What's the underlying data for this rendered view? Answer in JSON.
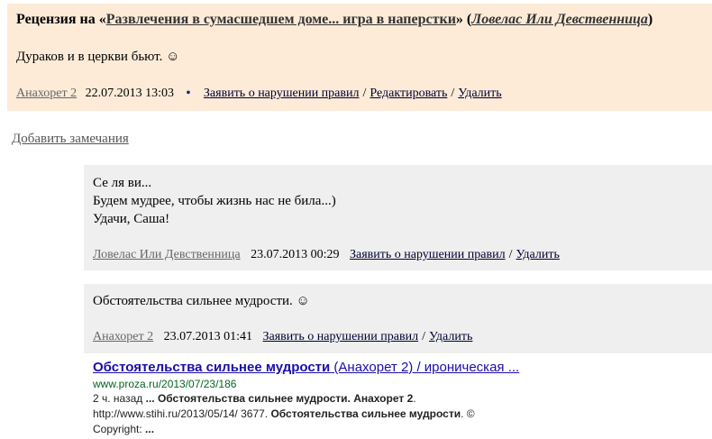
{
  "review": {
    "prefix": "Рецензия на «",
    "work_title": "Развлечения в сумасшедшем доме... игра в наперстки",
    "middle": "» (",
    "author": "Ловелас Или Девственница",
    "suffix": ")",
    "body": "Дураков и в церкви бьют. ☺",
    "user": "Анахорет 2",
    "timestamp": "22.07.2013 13:03",
    "bullet": "•",
    "report_label": "Заявить о нарушении правил",
    "edit_label": "Редактировать",
    "delete_label": "Удалить",
    "separator": "/"
  },
  "add_remarks_label": "Добавить замечания",
  "comments": [
    {
      "lines": [
        "Се ля ви...",
        "Будем мудрее, чтобы жизнь нас не била...)",
        "Удачи, Саша!"
      ],
      "user": "Ловелас Или Девственница",
      "timestamp": "23.07.2013 00:29",
      "report_label": "Заявить о нарушении правил",
      "delete_label": "Удалить"
    },
    {
      "lines": [
        "Обстоятельства сильнее мудрости. ☺"
      ],
      "user": "Анахорет 2",
      "timestamp": "23.07.2013 01:41",
      "report_label": "Заявить о нарушении правил",
      "delete_label": "Удалить"
    }
  ],
  "search_result": {
    "title_bold": "Обстоятельства сильнее мудрости",
    "title_rest": " (Анахорет 2) / ироническая ...",
    "url": "www.proza.ru/2013/07/23/186",
    "snippet_line1_pre": "2 ч. назад ",
    "snippet_line1_bold": "... Обстоятельства сильнее мудрости. Анахорет 2",
    "snippet_line1_post": ".",
    "snippet_line2_pre": "http://www.stihi.ru/2013/05/14/ 3677. ",
    "snippet_line2_bold": "Обстоятельства сильнее мудрости",
    "snippet_line2_post": ". ©",
    "snippet_line3_pre": "Copyright: ",
    "snippet_line3_bold": "..."
  },
  "colors": {
    "review_bg": "#fdebd8",
    "comment_bg": "#efefef",
    "search_title": "#1a0dab",
    "search_url": "#006621"
  }
}
